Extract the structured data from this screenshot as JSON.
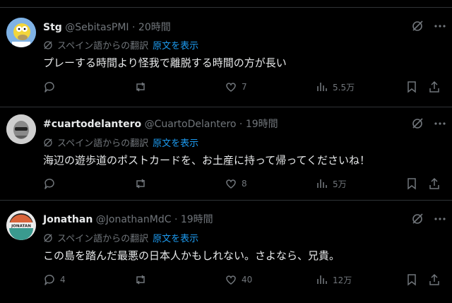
{
  "translate_label": "スペイン語からの翻訳",
  "show_original": "原文を表示",
  "tweets": [
    {
      "name": "Stg",
      "handle": "@SebitasPMI",
      "time": "20時間",
      "text": "プレーする時間より怪我で離脱する時間の方が長い",
      "replies": "",
      "reposts": "",
      "likes": "7",
      "views": "5.5万"
    },
    {
      "name": "#cuartodelantero",
      "handle": "@CuartoDelantero",
      "time": "19時間",
      "text": "海辺の遊歩道のポストカードを、お土産に持って帰ってくださいね！",
      "replies": "",
      "reposts": "",
      "likes": "8",
      "views": "5万"
    },
    {
      "name": "Jonathan",
      "handle": "@JonathanMdC",
      "time": "19時間",
      "text": "この島を踏んだ最悪の日本人かもしれない。さよなら、兄貴。",
      "replies": "4",
      "reposts": "",
      "likes": "40",
      "views": "12万",
      "avatar_text": "JONATAN"
    }
  ],
  "colors": {
    "background": "#000000",
    "text": "#e7e9ea",
    "muted": "#71767b",
    "link": "#1d9bf0",
    "divider": "#2f3336"
  }
}
